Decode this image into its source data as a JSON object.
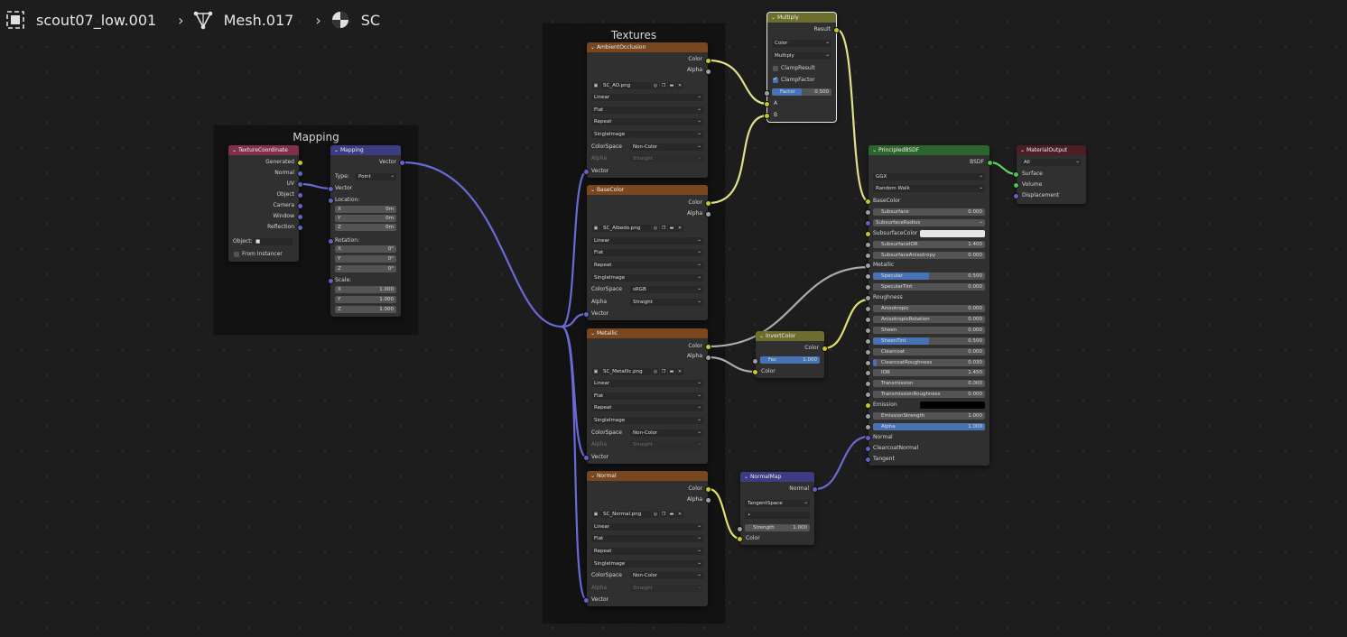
{
  "breadcrumb": {
    "object": "scout07_low.001",
    "mesh": "Mesh.017",
    "material": "SC"
  },
  "frames": {
    "mapping": "Mapping",
    "textures": "Textures"
  },
  "colors": {
    "texture_header": "#83314a",
    "vector_header": "#3c3c83",
    "image_header": "#79461d",
    "color_header": "#6d6d2e",
    "shader_header": "#2b652b",
    "output_header": "#4b1e26",
    "accent": "#4772b3"
  },
  "texcoord": {
    "title": "TextureCoordinate",
    "outputs": [
      "Generated",
      "Normal",
      "UV",
      "Object",
      "Camera",
      "Window",
      "Reflection"
    ],
    "object_label": "Object:",
    "from_instancer": "From Instancer"
  },
  "mapping": {
    "title": "Mapping",
    "output": "Vector",
    "type_label": "Type:",
    "type_value": "Point",
    "vector": "Vector",
    "location": "Location:",
    "loc": [
      {
        "a": "X",
        "v": "0m"
      },
      {
        "a": "Y",
        "v": "0m"
      },
      {
        "a": "Z",
        "v": "0m"
      }
    ],
    "rotation": "Rotation:",
    "rot": [
      {
        "a": "X",
        "v": "0°"
      },
      {
        "a": "Y",
        "v": "0°"
      },
      {
        "a": "Z",
        "v": "0°"
      }
    ],
    "scale": "Scale:",
    "scl": [
      {
        "a": "X",
        "v": "1.000"
      },
      {
        "a": "Y",
        "v": "1.000"
      },
      {
        "a": "Z",
        "v": "1.000"
      }
    ]
  },
  "images": [
    {
      "title": "AmbientOcclusion",
      "file": "SC_AO.png",
      "interp": "Linear",
      "proj": "Flat",
      "ext": "Repeat",
      "src": "SingleImage",
      "cs_label": "ColorSpace",
      "cs": "Non-Color",
      "alpha_label": "Alpha",
      "alpha": "Straight",
      "alpha_enabled": false,
      "out_color": "Color",
      "out_alpha": "Alpha",
      "in_vector": "Vector"
    },
    {
      "title": "BaseColor",
      "file": "SC_Albedo.png",
      "interp": "Linear",
      "proj": "Flat",
      "ext": "Repeat",
      "src": "SingleImage",
      "cs_label": "ColorSpace",
      "cs": "sRGB",
      "alpha_label": "Alpha",
      "alpha": "Straight",
      "alpha_enabled": true,
      "out_color": "Color",
      "out_alpha": "Alpha",
      "in_vector": "Vector"
    },
    {
      "title": "Metallic",
      "file": "SC_Metallic.png",
      "interp": "Linear",
      "proj": "Flat",
      "ext": "Repeat",
      "src": "SingleImage",
      "cs_label": "ColorSpace",
      "cs": "Non-Color",
      "alpha_label": "Alpha",
      "alpha": "Straight",
      "alpha_enabled": false,
      "out_color": "Color",
      "out_alpha": "Alpha",
      "in_vector": "Vector"
    },
    {
      "title": "Normal",
      "file": "SC_Normal.png",
      "interp": "Linear",
      "proj": "Flat",
      "ext": "Repeat",
      "src": "SingleImage",
      "cs_label": "ColorSpace",
      "cs": "Non-Color",
      "alpha_label": "Alpha",
      "alpha": "Straight",
      "alpha_enabled": false,
      "out_color": "Color",
      "out_alpha": "Alpha",
      "in_vector": "Vector"
    }
  ],
  "multiply": {
    "title": "Multiply",
    "output": "Result",
    "type": "Color",
    "blend": "Multiply",
    "clamp_result": "ClampResult",
    "clamp_result_on": false,
    "clamp_factor": "ClampFactor",
    "clamp_factor_on": true,
    "factor_label": "Factor",
    "factor_value": "0.500",
    "factor_fraction": 0.5,
    "in_a": "A",
    "in_b": "B"
  },
  "invert": {
    "title": "InvertColor",
    "output": "Color",
    "fac_label": "Fac",
    "fac_value": "1.000",
    "fac_fraction": 1.0,
    "input": "Color"
  },
  "normalmap": {
    "title": "NormalMap",
    "output": "Normal",
    "space": "TangentSpace",
    "uvmap": "•",
    "strength_label": "Strength",
    "strength_value": "1.000",
    "input": "Color"
  },
  "bsdf": {
    "title": "PrincipledBSDF",
    "output": "BSDF",
    "distribution": "GGX",
    "sss_method": "Random Walk",
    "rows": [
      {
        "k": "socket",
        "label": "BaseColor",
        "sock": "yel"
      },
      {
        "k": "slider",
        "label": "Subsurface",
        "value": "0.000",
        "fill": 0,
        "sock": "gry"
      },
      {
        "k": "dropdown",
        "label": "SubsurfaceRadius",
        "sock": "blu"
      },
      {
        "k": "swatch",
        "label": "SubsurfaceColor",
        "color": "#e6e6e6",
        "sock": "yel"
      },
      {
        "k": "slider",
        "label": "SubsurfaceIOR",
        "value": "1.400",
        "fill": 0,
        "sock": "gry"
      },
      {
        "k": "slider",
        "label": "SubsurfaceAnisotropy",
        "value": "0.000",
        "fill": 0,
        "sock": "gry"
      },
      {
        "k": "socket",
        "label": "Metallic",
        "sock": "gry"
      },
      {
        "k": "slider",
        "label": "Specular",
        "value": "0.500",
        "fill": 0.5,
        "sock": "gry"
      },
      {
        "k": "slider",
        "label": "SpecularTint",
        "value": "0.000",
        "fill": 0,
        "sock": "gry"
      },
      {
        "k": "socket",
        "label": "Roughness",
        "sock": "gry"
      },
      {
        "k": "slider",
        "label": "Anisotropic",
        "value": "0.000",
        "fill": 0,
        "sock": "gry"
      },
      {
        "k": "slider",
        "label": "AnisotropicRotation",
        "value": "0.000",
        "fill": 0,
        "sock": "gry"
      },
      {
        "k": "slider",
        "label": "Sheen",
        "value": "0.000",
        "fill": 0,
        "sock": "gry"
      },
      {
        "k": "slider",
        "label": "SheenTint",
        "value": "0.500",
        "fill": 0.5,
        "sock": "gry"
      },
      {
        "k": "slider",
        "label": "Clearcoat",
        "value": "0.000",
        "fill": 0,
        "sock": "gry"
      },
      {
        "k": "slider",
        "label": "ClearcoatRoughness",
        "value": "0.030",
        "fill": 0.03,
        "sock": "gry"
      },
      {
        "k": "slider",
        "label": "IOR",
        "value": "1.450",
        "fill": 0,
        "sock": "gry"
      },
      {
        "k": "slider",
        "label": "Transmission",
        "value": "0.000",
        "fill": 0,
        "sock": "gry"
      },
      {
        "k": "slider",
        "label": "TransmissionRoughness",
        "value": "0.000",
        "fill": 0,
        "sock": "gry"
      },
      {
        "k": "swatch",
        "label": "Emission",
        "color": "#000000",
        "sock": "yel"
      },
      {
        "k": "slider",
        "label": "EmissionStrength",
        "value": "1.000",
        "fill": 0,
        "sock": "gry"
      },
      {
        "k": "slider",
        "label": "Alpha",
        "value": "1.000",
        "fill": 1,
        "sock": "gry"
      },
      {
        "k": "socket",
        "label": "Normal",
        "sock": "blu"
      },
      {
        "k": "socket",
        "label": "ClearcoatNormal",
        "sock": "blu"
      },
      {
        "k": "socket",
        "label": "Tangent",
        "sock": "blu"
      }
    ]
  },
  "output": {
    "title": "MaterialOutput",
    "target": "All",
    "inputs": [
      "Surface",
      "Volume",
      "Displacement"
    ]
  }
}
